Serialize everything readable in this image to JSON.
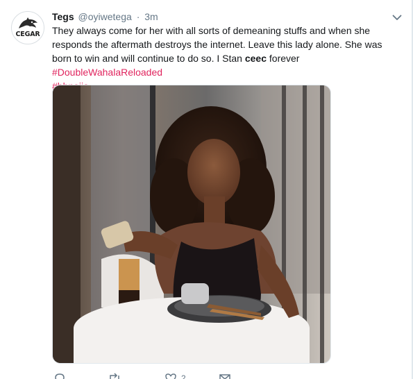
{
  "tweet": {
    "author_name": "Tegs",
    "handle": "@oyiwetega",
    "separator": "·",
    "time": "3m",
    "avatar_label": "CEGAR",
    "text_before_bold": "They always come for her with all sorts of demeaning stuffs and when she responds the aftermath destroys the internet. Leave this lady alone. She was born to win and will continue to do so. I Stan ",
    "bold_word": "ceec",
    "text_after_bold": " forever ",
    "hashtag_1": "#DoubleWahalaReloaded",
    "hashtag_2": "#bbnaija",
    "hashtag_color": "#e0245e",
    "like_count": "2"
  },
  "icons": {
    "caret": "chevron-down-icon",
    "reply": "reply-icon",
    "retweet": "retweet-icon",
    "like": "heart-icon",
    "dm": "envelope-icon"
  }
}
